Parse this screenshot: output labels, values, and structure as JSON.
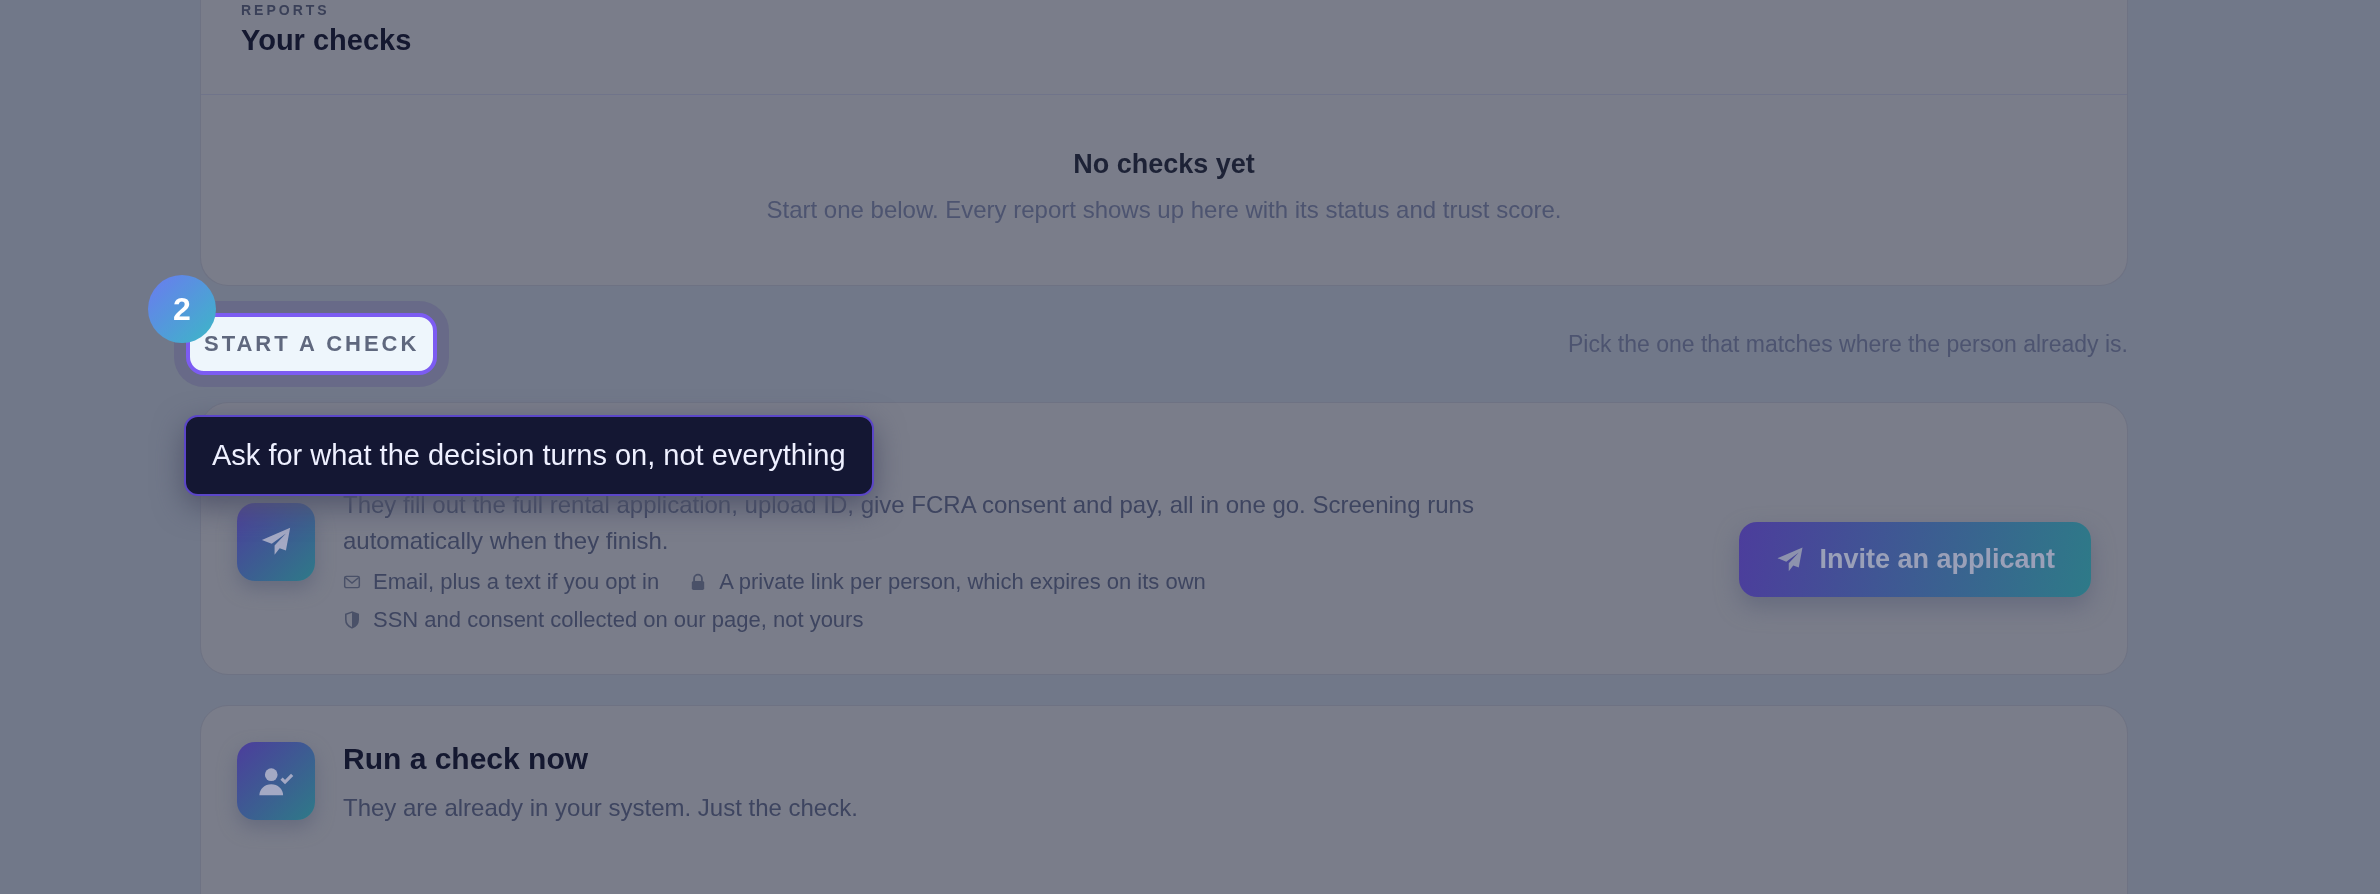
{
  "reports": {
    "eyebrow": "REPORTS",
    "title": "Your checks",
    "empty_title": "No checks yet",
    "empty_text": "Start one below. Every report shows up here with its status and trust score."
  },
  "section": {
    "label": "START A CHECK",
    "highlighted": true,
    "hint": "Pick the one that matches where the person already is."
  },
  "tour": {
    "step": "2",
    "tooltip": "Ask for what the decision turns on, not everything"
  },
  "options": [
    {
      "kind": "plane",
      "description": "They fill out the full rental application, upload ID, give FCRA consent and pay, all in one go. Screening runs automatically when they finish.",
      "features": [
        {
          "kind": "mail",
          "text": "Email, plus a text if you opt in"
        },
        {
          "kind": "lock",
          "text": "A private link per person, which expires on its own"
        },
        {
          "kind": "shield",
          "text": "SSN and consent collected on our page, not yours"
        }
      ],
      "button": "Invite an applicant"
    },
    {
      "kind": "person-check",
      "title": "Run a check now",
      "description": "They are already in your system. Just the check."
    }
  ]
}
